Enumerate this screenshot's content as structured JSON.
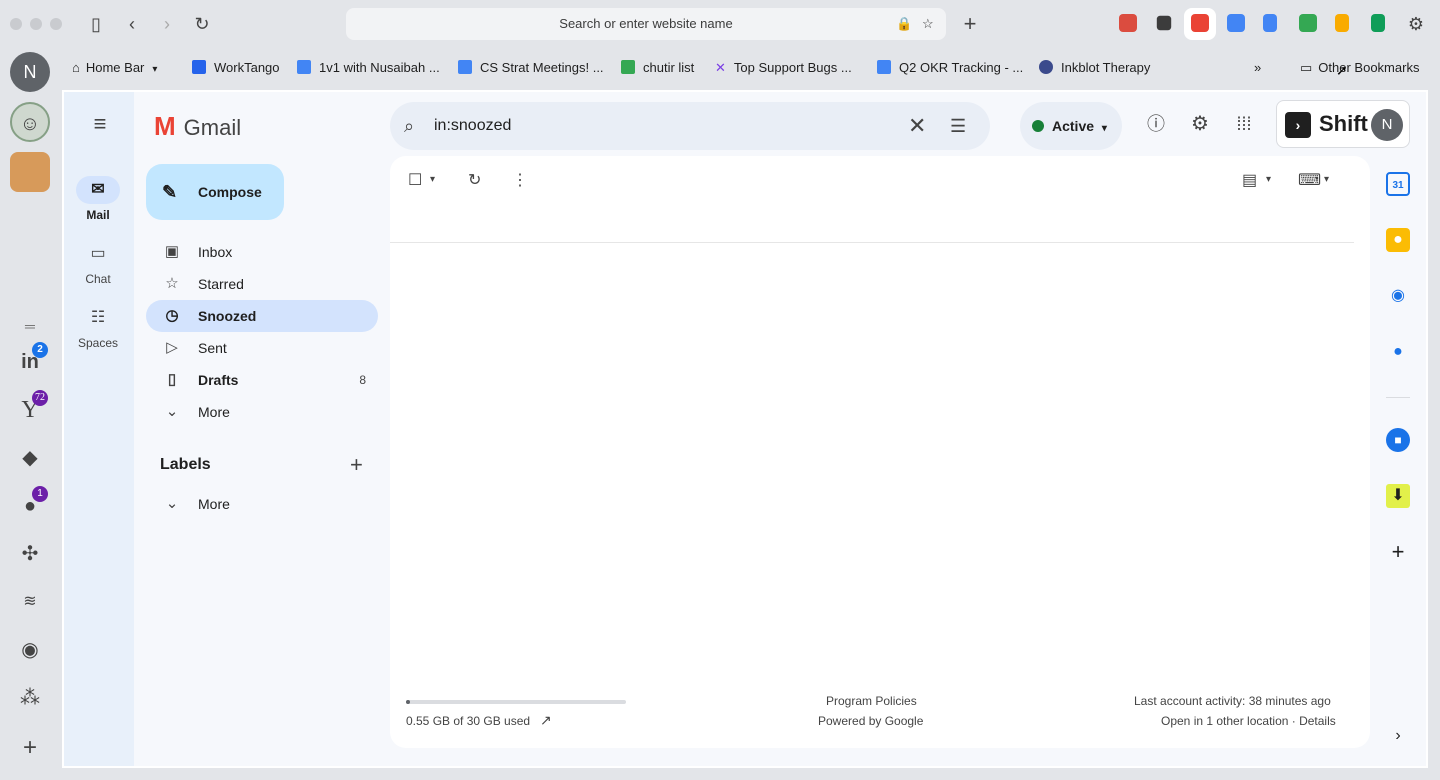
{
  "browser": {
    "url_placeholder": "Search or enter website name",
    "extensions": [
      {
        "icon": "todoist-icon",
        "color": "#db4c3f"
      },
      {
        "icon": "layers-icon",
        "color": "#3c3c3c"
      },
      {
        "icon": "gmail-icon",
        "color": "#ea4335"
      },
      {
        "icon": "calendar-icon",
        "color": "#4285f4"
      },
      {
        "icon": "docs-icon",
        "color": "#4285f4"
      },
      {
        "icon": "drive-icon",
        "color": "#34a853"
      },
      {
        "icon": "analytics-icon",
        "color": "#f9ab00"
      },
      {
        "icon": "sheets-icon",
        "color": "#0f9d58"
      }
    ]
  },
  "bookmarks": {
    "items": [
      {
        "label": "Home Bar",
        "icon": "home-icon"
      },
      {
        "label": "WorkTango",
        "icon": "worktango-icon"
      },
      {
        "label": "1v1 with Nusaibah ...",
        "icon": "doc-icon"
      },
      {
        "label": "CS Strat Meetings! ...",
        "icon": "doc-icon"
      },
      {
        "label": "chutir list",
        "icon": "drive-icon"
      },
      {
        "label": "Top Support Bugs ...",
        "icon": "x-icon"
      },
      {
        "label": "Q2 OKR Tracking - ...",
        "icon": "doc-icon"
      },
      {
        "label": "Inkblot Therapy",
        "icon": "inkblot-icon"
      }
    ],
    "other": "Other Bookmarks"
  },
  "dock": {
    "avatar_letter": "N",
    "badges": {
      "linkedin": "2",
      "yahoo": "72",
      "messenger": "1"
    }
  },
  "gmail": {
    "logo": "Gmail",
    "rail": [
      {
        "label": "Mail",
        "icon": "mail-icon"
      },
      {
        "label": "Chat",
        "icon": "chat-icon"
      },
      {
        "label": "Spaces",
        "icon": "spaces-icon"
      }
    ],
    "compose_label": "Compose",
    "nav": [
      {
        "label": "Inbox",
        "icon": "inbox-icon",
        "count": ""
      },
      {
        "label": "Starred",
        "icon": "star-icon",
        "count": ""
      },
      {
        "label": "Snoozed",
        "icon": "clock-icon",
        "count": ""
      },
      {
        "label": "Sent",
        "icon": "send-icon",
        "count": ""
      },
      {
        "label": "Drafts",
        "icon": "draft-icon",
        "count": "8"
      },
      {
        "label": "More",
        "icon": "chevron-down-icon",
        "count": ""
      }
    ],
    "labels_title": "Labels",
    "labels_more": "More",
    "search_value": "in:snoozed",
    "status": "Active",
    "shift_label": "Shift",
    "account_letter": "N",
    "footer": {
      "storage": "0.55 GB of 30 GB used",
      "storage_fraction": 0.018,
      "policies": "Program Policies",
      "powered": "Powered by Google",
      "activity": "Last account activity: 38 minutes ago",
      "location": "Open in 1 other location · Details"
    }
  }
}
